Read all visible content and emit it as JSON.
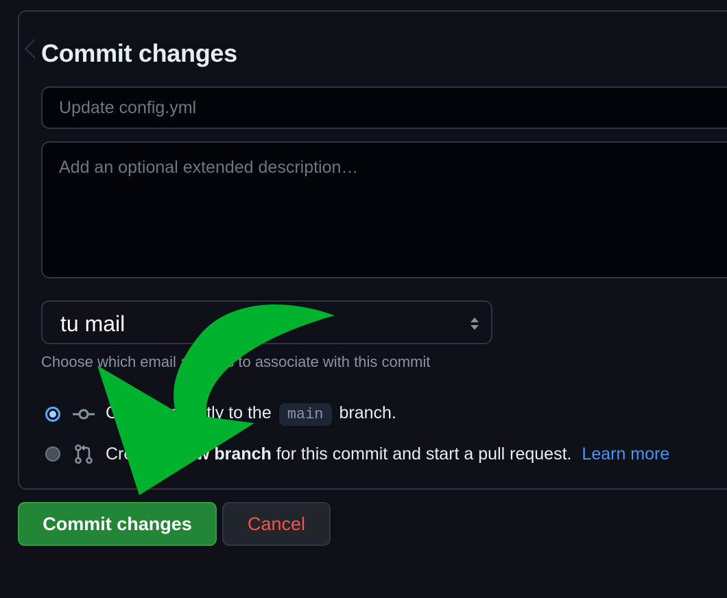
{
  "dialog": {
    "title": "Commit changes",
    "summary_placeholder": "Update config.yml",
    "description_placeholder": "Add an optional extended description…",
    "email_select": {
      "selected": "tu mail",
      "hint": "Choose which email address to associate with this commit"
    },
    "options": [
      {
        "icon": "git-commit-icon",
        "prefix": "Commit directly to the",
        "branch": "main",
        "suffix": "branch.",
        "checked": true
      },
      {
        "icon": "git-pull-request-icon",
        "prefix": "Create a",
        "bold": "new branch",
        "suffix": "for this commit and start a pull request.",
        "link": "Learn more",
        "checked": false
      }
    ]
  },
  "buttons": {
    "commit_label": "Commit changes",
    "cancel_label": "Cancel"
  },
  "annotation": {
    "arrow_color": "#00b22d",
    "arrow_icon": "green-curved-arrow"
  },
  "colors": {
    "background": "#0d1117",
    "primary_button": "#238636",
    "danger_text": "#f85149",
    "link": "#4493f8"
  }
}
